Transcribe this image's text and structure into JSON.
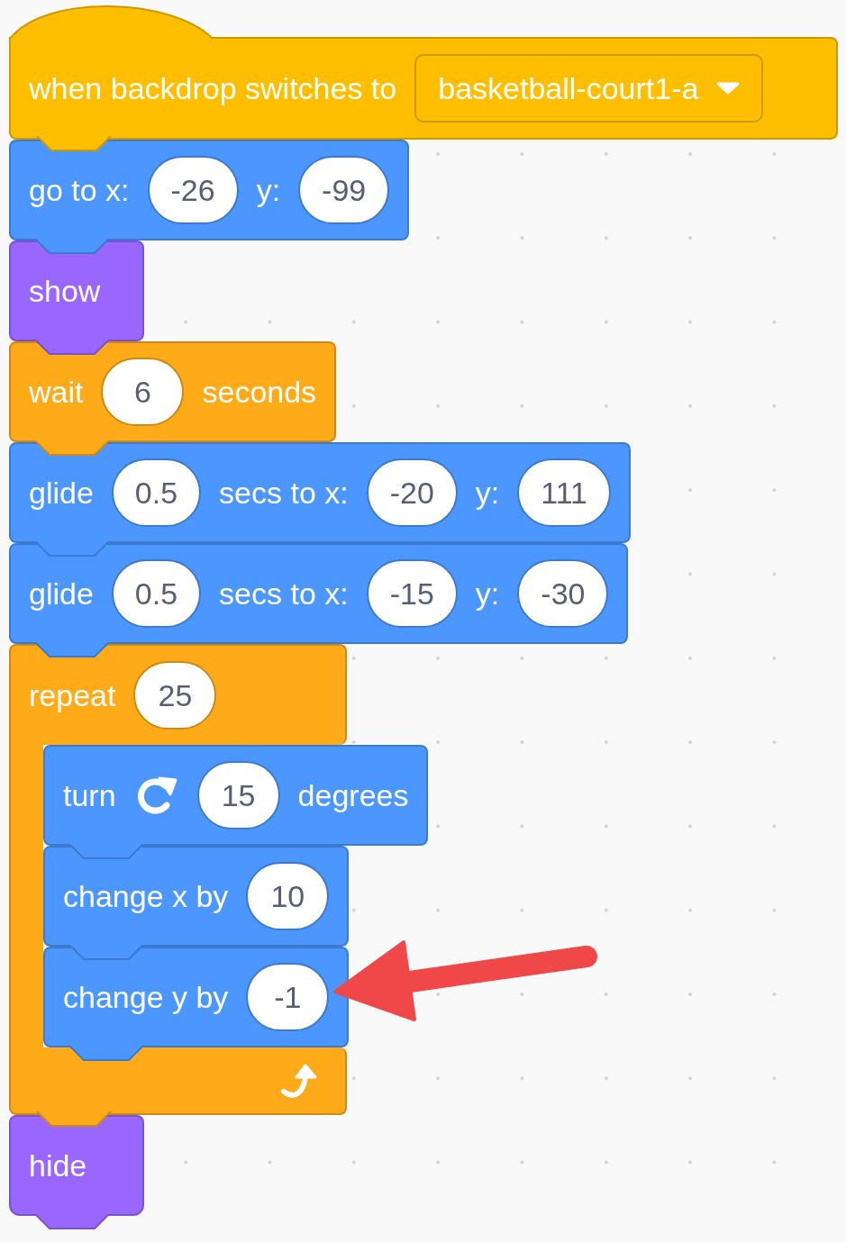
{
  "blocks": [
    {
      "kind": "hat",
      "color": "#ffbf00",
      "parts": [
        {
          "kind": "label",
          "text": "when backdrop switches to"
        },
        {
          "kind": "dropdown",
          "text": "basketball-court1-a"
        }
      ]
    },
    {
      "kind": "stack",
      "color": "#4c97ff",
      "parts": [
        {
          "kind": "label",
          "text": "go to x:"
        },
        {
          "kind": "input",
          "text": "-26"
        },
        {
          "kind": "label",
          "text": "y:"
        },
        {
          "kind": "input",
          "text": "-99"
        }
      ]
    },
    {
      "kind": "stack",
      "color": "#9966ff",
      "parts": [
        {
          "kind": "label",
          "text": "show"
        }
      ]
    },
    {
      "kind": "stack",
      "color": "#ffab19",
      "parts": [
        {
          "kind": "label",
          "text": "wait"
        },
        {
          "kind": "input",
          "text": "6"
        },
        {
          "kind": "label",
          "text": "seconds"
        }
      ]
    },
    {
      "kind": "stack",
      "color": "#4c97ff",
      "parts": [
        {
          "kind": "label",
          "text": "glide"
        },
        {
          "kind": "input",
          "text": "0.5"
        },
        {
          "kind": "label",
          "text": "secs to x:"
        },
        {
          "kind": "input",
          "text": "-20"
        },
        {
          "kind": "label",
          "text": "y:"
        },
        {
          "kind": "input",
          "text": "111"
        }
      ]
    },
    {
      "kind": "stack",
      "color": "#4c97ff",
      "parts": [
        {
          "kind": "label",
          "text": "glide"
        },
        {
          "kind": "input",
          "text": "0.5"
        },
        {
          "kind": "label",
          "text": "secs to x:"
        },
        {
          "kind": "input",
          "text": "-15"
        },
        {
          "kind": "label",
          "text": "y:"
        },
        {
          "kind": "input",
          "text": "-30"
        }
      ]
    },
    {
      "kind": "c",
      "color": "#ffab19",
      "parts": [
        {
          "kind": "label",
          "text": "repeat"
        },
        {
          "kind": "input",
          "text": "25"
        }
      ],
      "children": [
        {
          "kind": "stack",
          "color": "#4c97ff",
          "parts": [
            {
              "kind": "label",
              "text": "turn"
            },
            {
              "kind": "icon"
            },
            {
              "kind": "input",
              "text": "15"
            },
            {
              "kind": "label",
              "text": "degrees"
            }
          ]
        },
        {
          "kind": "stack",
          "color": "#4c97ff",
          "parts": [
            {
              "kind": "label",
              "text": "change x by"
            },
            {
              "kind": "input",
              "text": "10"
            }
          ]
        },
        {
          "kind": "stack",
          "color": "#4c97ff",
          "parts": [
            {
              "kind": "label",
              "text": "change y by"
            },
            {
              "kind": "input",
              "text": "-1"
            }
          ]
        }
      ]
    },
    {
      "kind": "end",
      "color": "#9966ff",
      "parts": [
        {
          "kind": "label",
          "text": "hide"
        }
      ]
    }
  ]
}
